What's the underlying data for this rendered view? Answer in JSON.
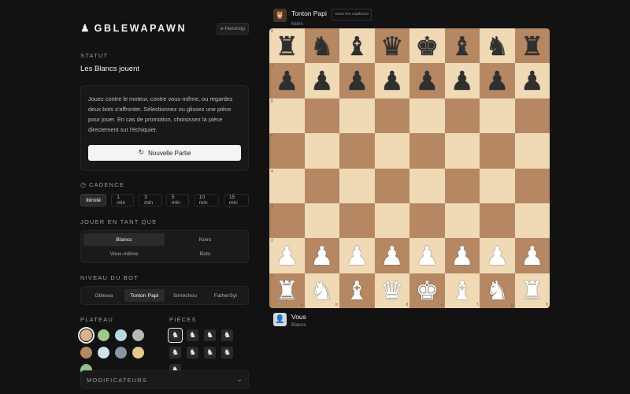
{
  "brand": {
    "icon": "pawn-icon",
    "name": "GBLEWAPAWN",
    "shop_link": "e-freeshop"
  },
  "status": {
    "label": "STATUT",
    "value": "Les Blancs jouent"
  },
  "info": {
    "text": "Jouez contre le moteur, contre vous-même, ou regardez deux bots s'affronter. Sélectionnez ou glissez une pièce pour jouer. En cas de promotion, choisissez la pièce directement sur l'échiquier.",
    "new_game_label": "Nouvelle Partie"
  },
  "cadence": {
    "label": "CADENCE",
    "options": [
      "Illimité",
      "1 min",
      "3 min",
      "5 min",
      "10 min",
      "15 min"
    ],
    "selected": "Illimité"
  },
  "play_as": {
    "label": "JOUER EN TANT QUE",
    "options": [
      "Blancs",
      "Noirs",
      "Vous-même",
      "Bots"
    ],
    "selected": "Blancs"
  },
  "bot_level": {
    "label": "NIVEAU DU BOT",
    "options": [
      "Gblewa",
      "Tonton Papi",
      "Siméchou",
      "FatherSyl"
    ],
    "selected": "Tonton Papi"
  },
  "plateau": {
    "label": "PLATEAU",
    "swatches": [
      "#d9b38c",
      "#9fca8a",
      "#b9d8e3",
      "#b8b8b8",
      "#b58863",
      "#cfe3ef",
      "#8a94a8",
      "#e4c98f",
      "#8fc08d"
    ],
    "selected_index": 0
  },
  "pieces": {
    "label": "PIÈCES",
    "count": 9,
    "selected_index": 0
  },
  "modifiers": {
    "label": "MODIFICATEURS"
  },
  "top_player": {
    "name": "Tonton Papi",
    "side": "Noirs",
    "captures_label": "sans les captures",
    "avatar": "owl-icon"
  },
  "bottom_player": {
    "name": "Vous",
    "side": "Blancs",
    "avatar": "user-icon"
  },
  "board": {
    "position": [
      [
        "r",
        "n",
        "b",
        "q",
        "k",
        "b",
        "n",
        "r"
      ],
      [
        "p",
        "p",
        "p",
        "p",
        "p",
        "p",
        "p",
        "p"
      ],
      [
        "",
        "",
        "",
        "",
        "",
        "",
        "",
        ""
      ],
      [
        "",
        "",
        "",
        "",
        "",
        "",
        "",
        ""
      ],
      [
        "",
        "",
        "",
        "",
        "",
        "",
        "",
        ""
      ],
      [
        "",
        "",
        "",
        "",
        "",
        "",
        "",
        ""
      ],
      [
        "P",
        "P",
        "P",
        "P",
        "P",
        "P",
        "P",
        "P"
      ],
      [
        "R",
        "N",
        "B",
        "Q",
        "K",
        "B",
        "N",
        "R"
      ]
    ],
    "files": [
      "a",
      "b",
      "c",
      "d",
      "e",
      "f",
      "g",
      "h"
    ],
    "ranks": [
      "8",
      "7",
      "6",
      "5",
      "4",
      "3",
      "2",
      "1"
    ]
  }
}
